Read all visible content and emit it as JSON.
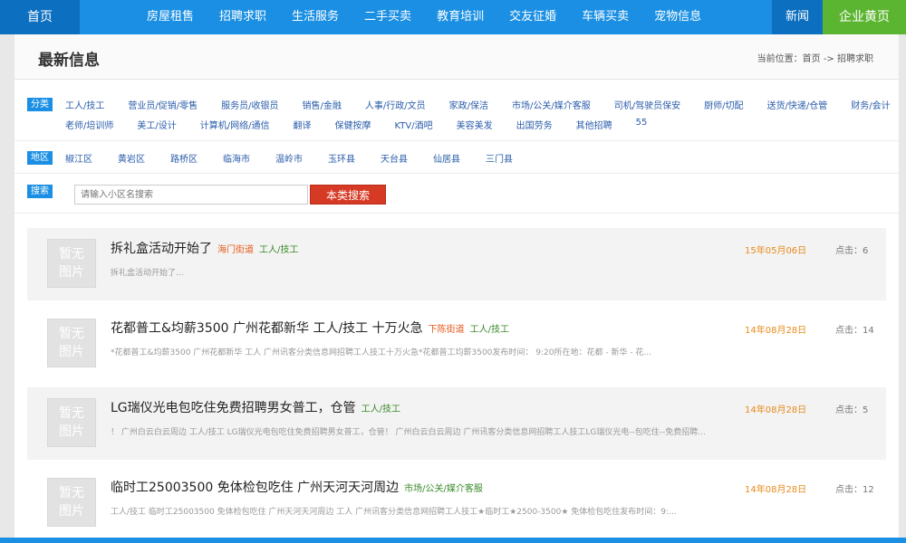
{
  "nav": {
    "home": "首页",
    "items": [
      "房屋租售",
      "招聘求职",
      "生活服务",
      "二手买卖",
      "教育培训",
      "交友征婚",
      "车辆买卖",
      "宠物信息"
    ],
    "news": "新闻",
    "corp": "企业黄页"
  },
  "header": {
    "title": "最新信息",
    "breadcrumb": "当前位置：首页 -> 招聘求职"
  },
  "filters": {
    "category_tag": "分类",
    "categories_row1": [
      "工人/技工",
      "营业员/促销/零售",
      "服务员/收银员",
      "销售/金融",
      "人事/行政/文员",
      "家政/保洁",
      "市场/公关/媒介客服",
      "司机/驾驶员保安",
      "厨师/切配",
      "送货/快递/仓管",
      "财务/会计"
    ],
    "categories_row2": [
      "老师/培训师",
      "美工/设计",
      "计算机/网络/通信",
      "翻译",
      "保健按摩",
      "KTV/酒吧",
      "美容美发",
      "出国劳务",
      "其他招聘",
      "55"
    ],
    "area_tag": "地区",
    "areas": [
      "椒江区",
      "黄岩区",
      "路桥区",
      "临海市",
      "温岭市",
      "玉环县",
      "天台县",
      "仙居县",
      "三门县"
    ],
    "search_tag": "搜索",
    "search_placeholder": "请输入小区名搜索",
    "search_button": "本类搜索"
  },
  "thumb_text": [
    "暂无",
    "图片"
  ],
  "listings": [
    {
      "title": "拆礼盒活动开始了",
      "location": "海门街道",
      "category": "工人/技工",
      "desc": "拆礼盒活动开始了...",
      "date": "15年05月06日",
      "clicks": "点击：6"
    },
    {
      "title": "花都普工&均薪3500 广州花都新华 工人/技工 十万火急",
      "location": "下陈街道",
      "category": "工人/技工",
      "desc": "*花都普工&均薪3500 广州花都新华 工人 广州讯客分类信息网招聘工人技工十万火急*花都普工均薪3500发布时间： 9:20所在地：花都 - 新华 - 花...",
      "date": "14年08月28日",
      "clicks": "点击：14"
    },
    {
      "title": "LG瑞仪光电包吃住免费招聘男女普工，仓管",
      "location": "",
      "category": "工人/技工",
      "desc": "！ 广州白云白云周边 工人/技工 LG瑞仪光电包吃住免费招聘男女普工，仓管！ 广州白云白云周边 广州讯客分类信息网招聘工人技工LG瑞仪光电--包吃住--免费招聘...",
      "date": "14年08月28日",
      "clicks": "点击：5"
    },
    {
      "title": "临时工25003500 免体检包吃住 广州天河天河周边",
      "location": "",
      "category": "市场/公关/媒介客服",
      "desc": "工人/技工 临时工25003500 免体检包吃住 广州天河天河周边 工人 广州讯客分类信息网招聘工人技工★临时工★2500-3500★ 免体检包吃住发布时间：9:...",
      "date": "14年08月28日",
      "clicks": "点击：12"
    }
  ],
  "colors": {
    "nav_blue": "#1a8fe3",
    "nav_dark": "#0c6fc0",
    "corp_green": "#5cb531",
    "search_red": "#d63a24",
    "date_orange": "#e8891a",
    "location_orange": "#e45a18",
    "category_green": "#3a8a2a"
  }
}
